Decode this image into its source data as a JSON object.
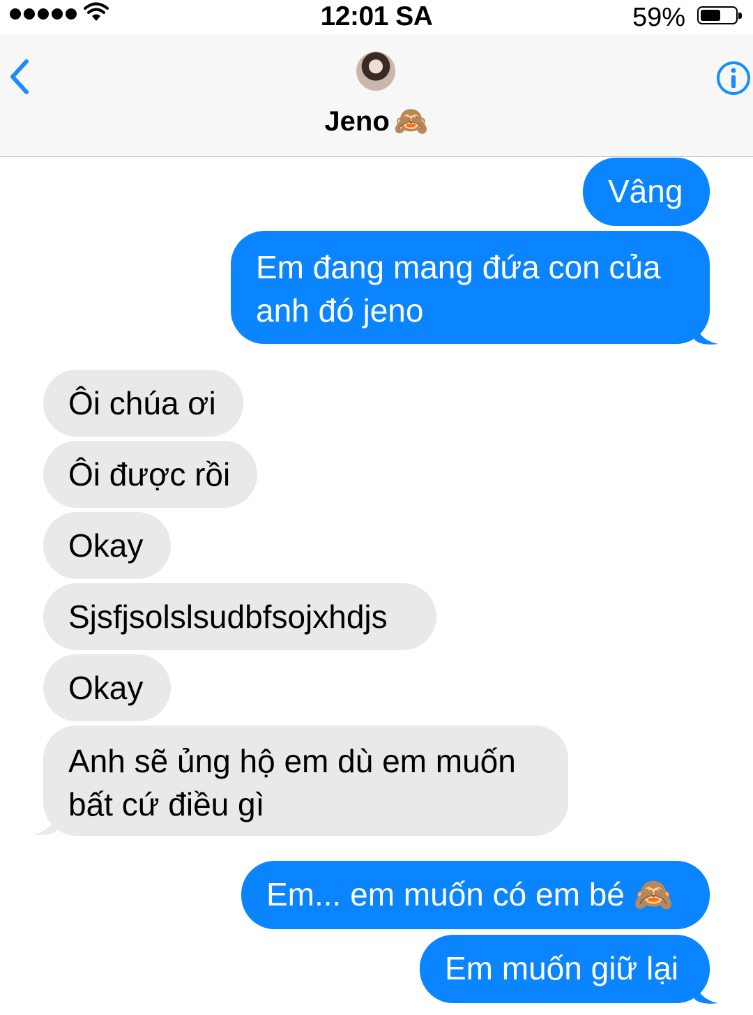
{
  "status_bar": {
    "time": "12:01 SA",
    "battery_percent": "59%",
    "battery_level": 0.59
  },
  "header": {
    "contact_name": "Jeno",
    "contact_emoji": "🙈",
    "back_icon": "chevron-left-icon",
    "info_icon": "info-circle-icon"
  },
  "colors": {
    "sent_bubble": "#0a84ff",
    "received_bubble": "#e9e9eb",
    "accent": "#1a8cff"
  },
  "messages": [
    {
      "side": "sent",
      "text": "Vâng"
    },
    {
      "side": "sent",
      "text": "Em đang mang đứa con của",
      "text2": "anh đó jeno"
    },
    {
      "side": "received",
      "text": "Ôi chúa ơi"
    },
    {
      "side": "received",
      "text": "Ôi được rồi"
    },
    {
      "side": "received",
      "text": "Okay"
    },
    {
      "side": "received",
      "text": "Sjsfjsolslsudbfsojxhdjs"
    },
    {
      "side": "received",
      "text": "Okay"
    },
    {
      "side": "received",
      "text": "Anh sẽ ủng hộ em dù em muốn",
      "text2": "bất cứ điều gì"
    },
    {
      "side": "sent",
      "text": "Em... em muốn có em bé",
      "emoji": "🙈"
    },
    {
      "side": "sent",
      "text": "Em muốn giữ lại"
    }
  ]
}
